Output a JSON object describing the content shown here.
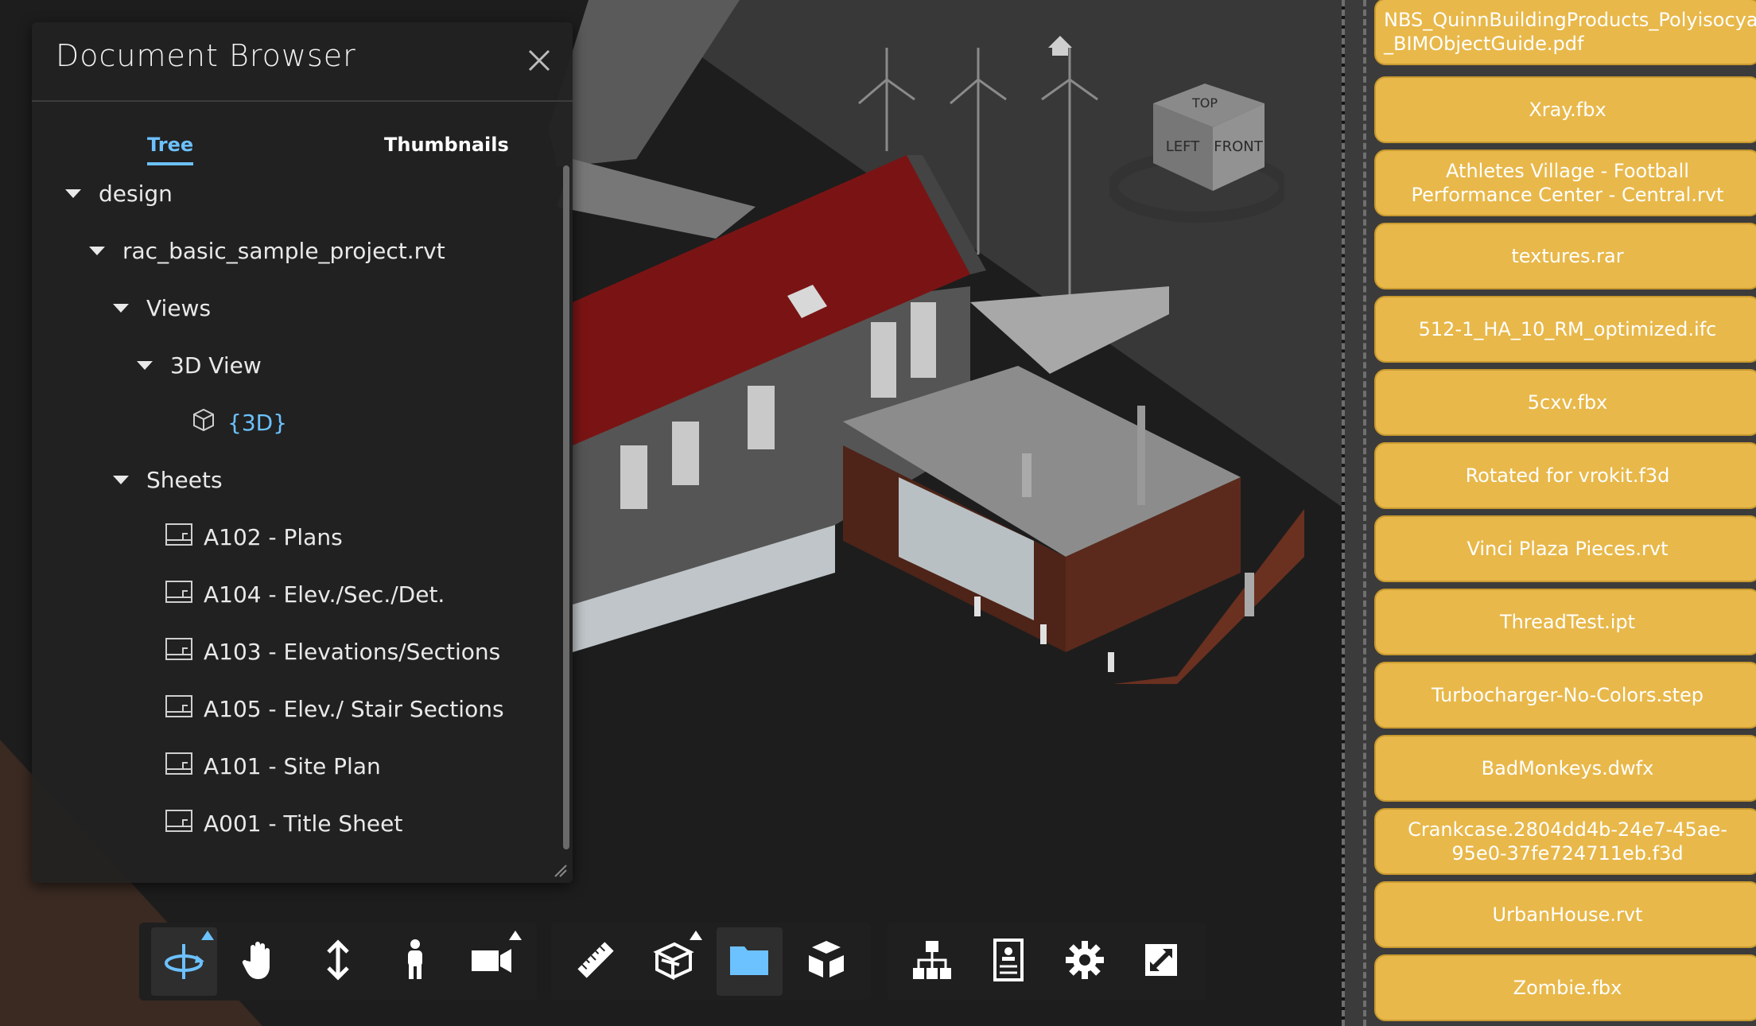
{
  "document_browser": {
    "title": "Document Browser",
    "tabs": [
      {
        "label": "Tree",
        "active": true
      },
      {
        "label": "Thumbnails",
        "active": false
      }
    ],
    "tree": [
      {
        "label": "design",
        "type": "folder",
        "expanded": true
      },
      {
        "label": "rac_basic_sample_project.rvt",
        "type": "folder",
        "expanded": true
      },
      {
        "label": "Views",
        "type": "folder",
        "expanded": true
      },
      {
        "label": "3D View",
        "type": "folder",
        "expanded": true
      },
      {
        "label": "{3D}",
        "type": "view3d",
        "selected": true
      },
      {
        "label": "Sheets",
        "type": "folder",
        "expanded": true
      },
      {
        "label": "A102 - Plans",
        "type": "sheet"
      },
      {
        "label": "A104 - Elev./Sec./Det.",
        "type": "sheet"
      },
      {
        "label": "A103 - Elevations/Sections",
        "type": "sheet"
      },
      {
        "label": "A105 - Elev./ Stair Sections",
        "type": "sheet"
      },
      {
        "label": "A101 - Site Plan",
        "type": "sheet"
      },
      {
        "label": "A001 - Title Sheet",
        "type": "sheet"
      }
    ]
  },
  "viewcube": {
    "top": "TOP",
    "left": "LEFT",
    "front": "FRONT"
  },
  "toolbar": {
    "groups": [
      [
        "orbit-icon",
        "pan-icon",
        "dolly-icon",
        "first-person-icon",
        "camera-icon"
      ],
      [
        "measure-icon",
        "section-icon",
        "model-browser-icon",
        "explode-icon"
      ],
      [
        "model-structure-icon",
        "properties-icon",
        "settings-icon",
        "fullscreen-icon"
      ]
    ],
    "active_tool": "orbit-icon",
    "active_panel": "model-browser-icon"
  },
  "sample_files": [
    "NBS_QuinnBuildingProducts_Polyisocyanurate\n_BIMObjectGuide.pdf",
    "Xray.fbx",
    "Athletes Village - Football\nPerformance Center - Central.rvt",
    "textures.rar",
    "512-1_HA_10_RM_optimized.ifc",
    "5cxv.fbx",
    "Rotated for vrokit.f3d",
    "Vinci Plaza Pieces.rvt",
    "ThreadTest.ipt",
    "Turbocharger-No-Colors.step",
    "BadMonkeys.dwfx",
    "Crankcase.2804dd4b-24e7-45ae-\n95e0-37fe724711eb.f3d",
    "UrbanHouse.rvt",
    "Zombie.fbx"
  ],
  "colors": {
    "accent": "#6cc1ff",
    "sample_button": "#e8b84a",
    "roof": "#7a1414",
    "wall": "#5b2a1c"
  }
}
